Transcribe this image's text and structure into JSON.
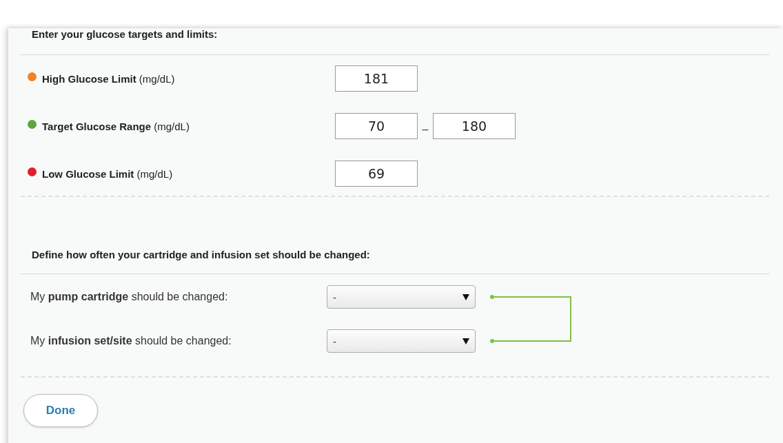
{
  "targets": {
    "heading": "Enter your glucose targets and limits:",
    "rows": [
      {
        "label": "**High Glucose Limit** (mg/dL)",
        "color": "#f0822a",
        "values": [
          "181"
        ]
      },
      {
        "label": "**Target Glucose Range** (mg/dL)",
        "color": "#5aa83c",
        "values": [
          "70",
          "180"
        ],
        "separator": "–"
      },
      {
        "label": "**Low Glucose Limit** (mg/dL)",
        "color": "#e0202e",
        "values": [
          "69"
        ]
      }
    ]
  },
  "changes": {
    "heading": "Define how often your cartridge and infusion set should be changed:",
    "rows": [
      {
        "label": "My **pump cartridge** should be changed:",
        "value": "-"
      },
      {
        "label": "My **infusion set/site** should be changed:",
        "value": "-"
      }
    ]
  },
  "done_button": "Done"
}
